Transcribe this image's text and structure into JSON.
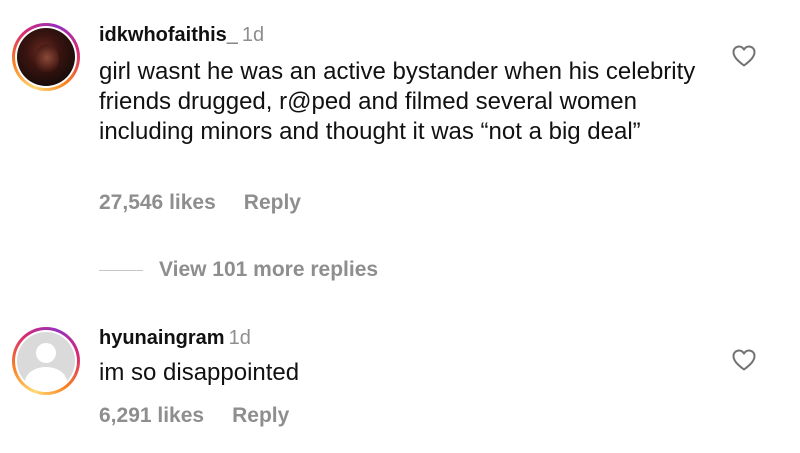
{
  "comments": [
    {
      "username": "idkwhofaithis_",
      "time": "1d",
      "text": "girl wasnt he was an active bystander when his celebrity friends drugged, r@ped and filmed several women including minors and thought it was “not a big deal”",
      "likes": "27,546 likes",
      "reply_label": "Reply",
      "avatar": "profile-photo",
      "heart_icon": "heart-outline-icon"
    },
    {
      "username": "hyunaingram",
      "time": "1d",
      "text": "im so disappointed",
      "likes": "6,291 likes",
      "reply_label": "Reply",
      "avatar": "default-avatar",
      "heart_icon": "heart-outline-icon"
    }
  ],
  "view_replies": {
    "label": "View 101 more replies"
  },
  "colors": {
    "text_primary": "#111111",
    "text_secondary": "#8e8e8e",
    "story_ring": [
      "#feda75",
      "#fa7e1e",
      "#d62976",
      "#962fbf"
    ]
  }
}
